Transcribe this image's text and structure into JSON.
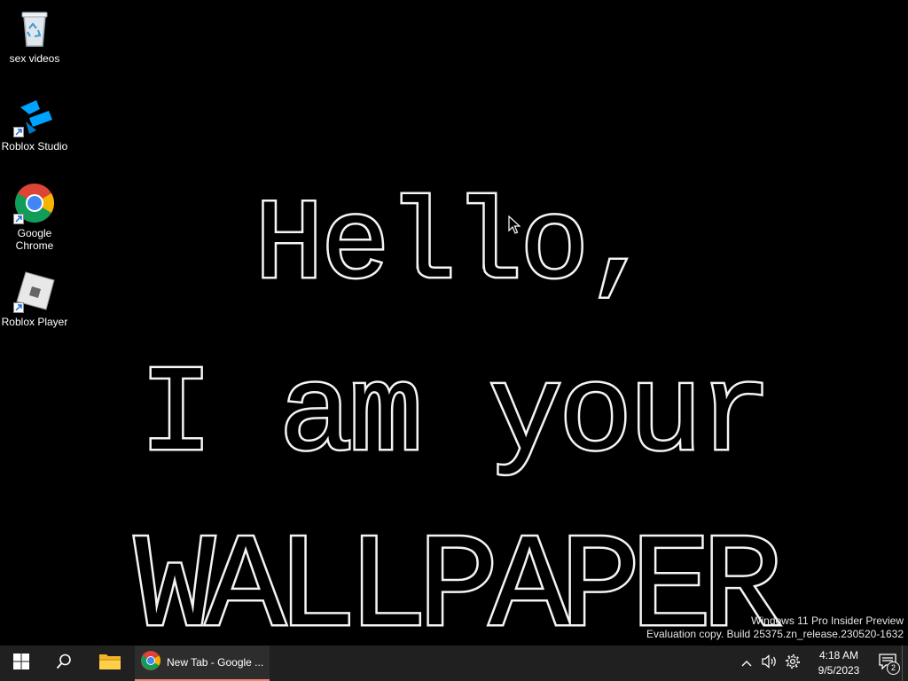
{
  "desktop": {
    "icons": [
      {
        "label": "sex videos",
        "icon": "recycle-bin-icon"
      },
      {
        "label": "Roblox Studio",
        "icon": "roblox-studio-icon"
      },
      {
        "label": "Google Chrome",
        "icon": "chrome-icon"
      },
      {
        "label": "Roblox Player",
        "icon": "roblox-player-icon"
      }
    ],
    "wallpaper": {
      "line1": "Hello,",
      "line2": "I am your",
      "line3": "WALLPAPER"
    },
    "watermark": {
      "line1": "Windows 11 Pro Insider Preview",
      "line2": "Evaluation copy. Build 25375.zn_release.230520-1632"
    }
  },
  "taskbar": {
    "start_icon": "windows-logo-icon",
    "search_icon": "search-icon",
    "explorer_icon": "file-explorer-icon",
    "active_task": {
      "label": "New Tab - Google ...",
      "icon": "chrome-icon"
    },
    "tray": {
      "overflow_icon": "chevron-up-icon",
      "volume_icon": "speaker-icon",
      "settings_icon": "gear-icon",
      "time": "4:18 AM",
      "date": "9/5/2023",
      "notification_count": "2"
    },
    "colors": {
      "background": "#202020",
      "active_underline": "#f08a77"
    }
  }
}
